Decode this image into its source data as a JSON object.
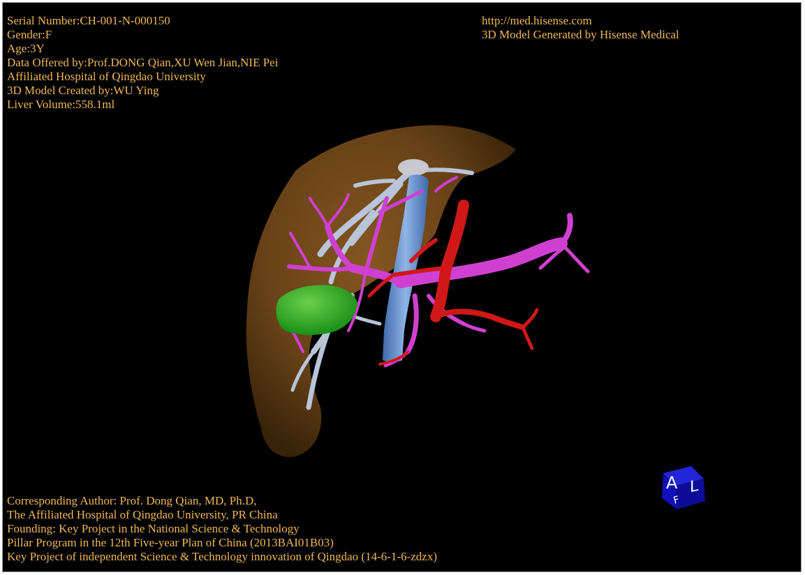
{
  "top_left_info": [
    "Serial Number:CH-001-N-000150",
    "Gender:F",
    "Age:3Y",
    "Data Offered by:Prof.DONG Qian,XU Wen Jian,NIE Pei",
    "Affiliated Hospital of Qingdao University",
    "3D Model Created by:WU Ying",
    "Liver Volume:558.1ml"
  ],
  "top_right_info": [
    "http://med.hisense.com",
    "3D Model Generated by Hisense Medical"
  ],
  "bottom_info": [
    "Corresponding Author: Prof. Dong Qian, MD, Ph.D,",
    "The Affiliated Hospital of Qingdao University, PR China",
    "Founding: Key Project in the National Science & Technology",
    "Pillar Program in the 12th Five-year Plan of China (2013BAI01B03)",
    "Key Project of independent Science & Technology innovation of Qingdao (14-6-1-6-zdzx)"
  ],
  "orientation_cube": {
    "front_label": "A",
    "side_label": "L",
    "top_label": "F"
  },
  "colors": {
    "text": "#f0b858",
    "background": "#000000",
    "liver": "#6b4418",
    "hepatic_vein": "#b8c4d8",
    "portal_vein": "#d040d0",
    "artery": "#d01818",
    "vena_cava": "#5a86c8",
    "tumor": "#28a828",
    "cube": "#1010b8"
  }
}
